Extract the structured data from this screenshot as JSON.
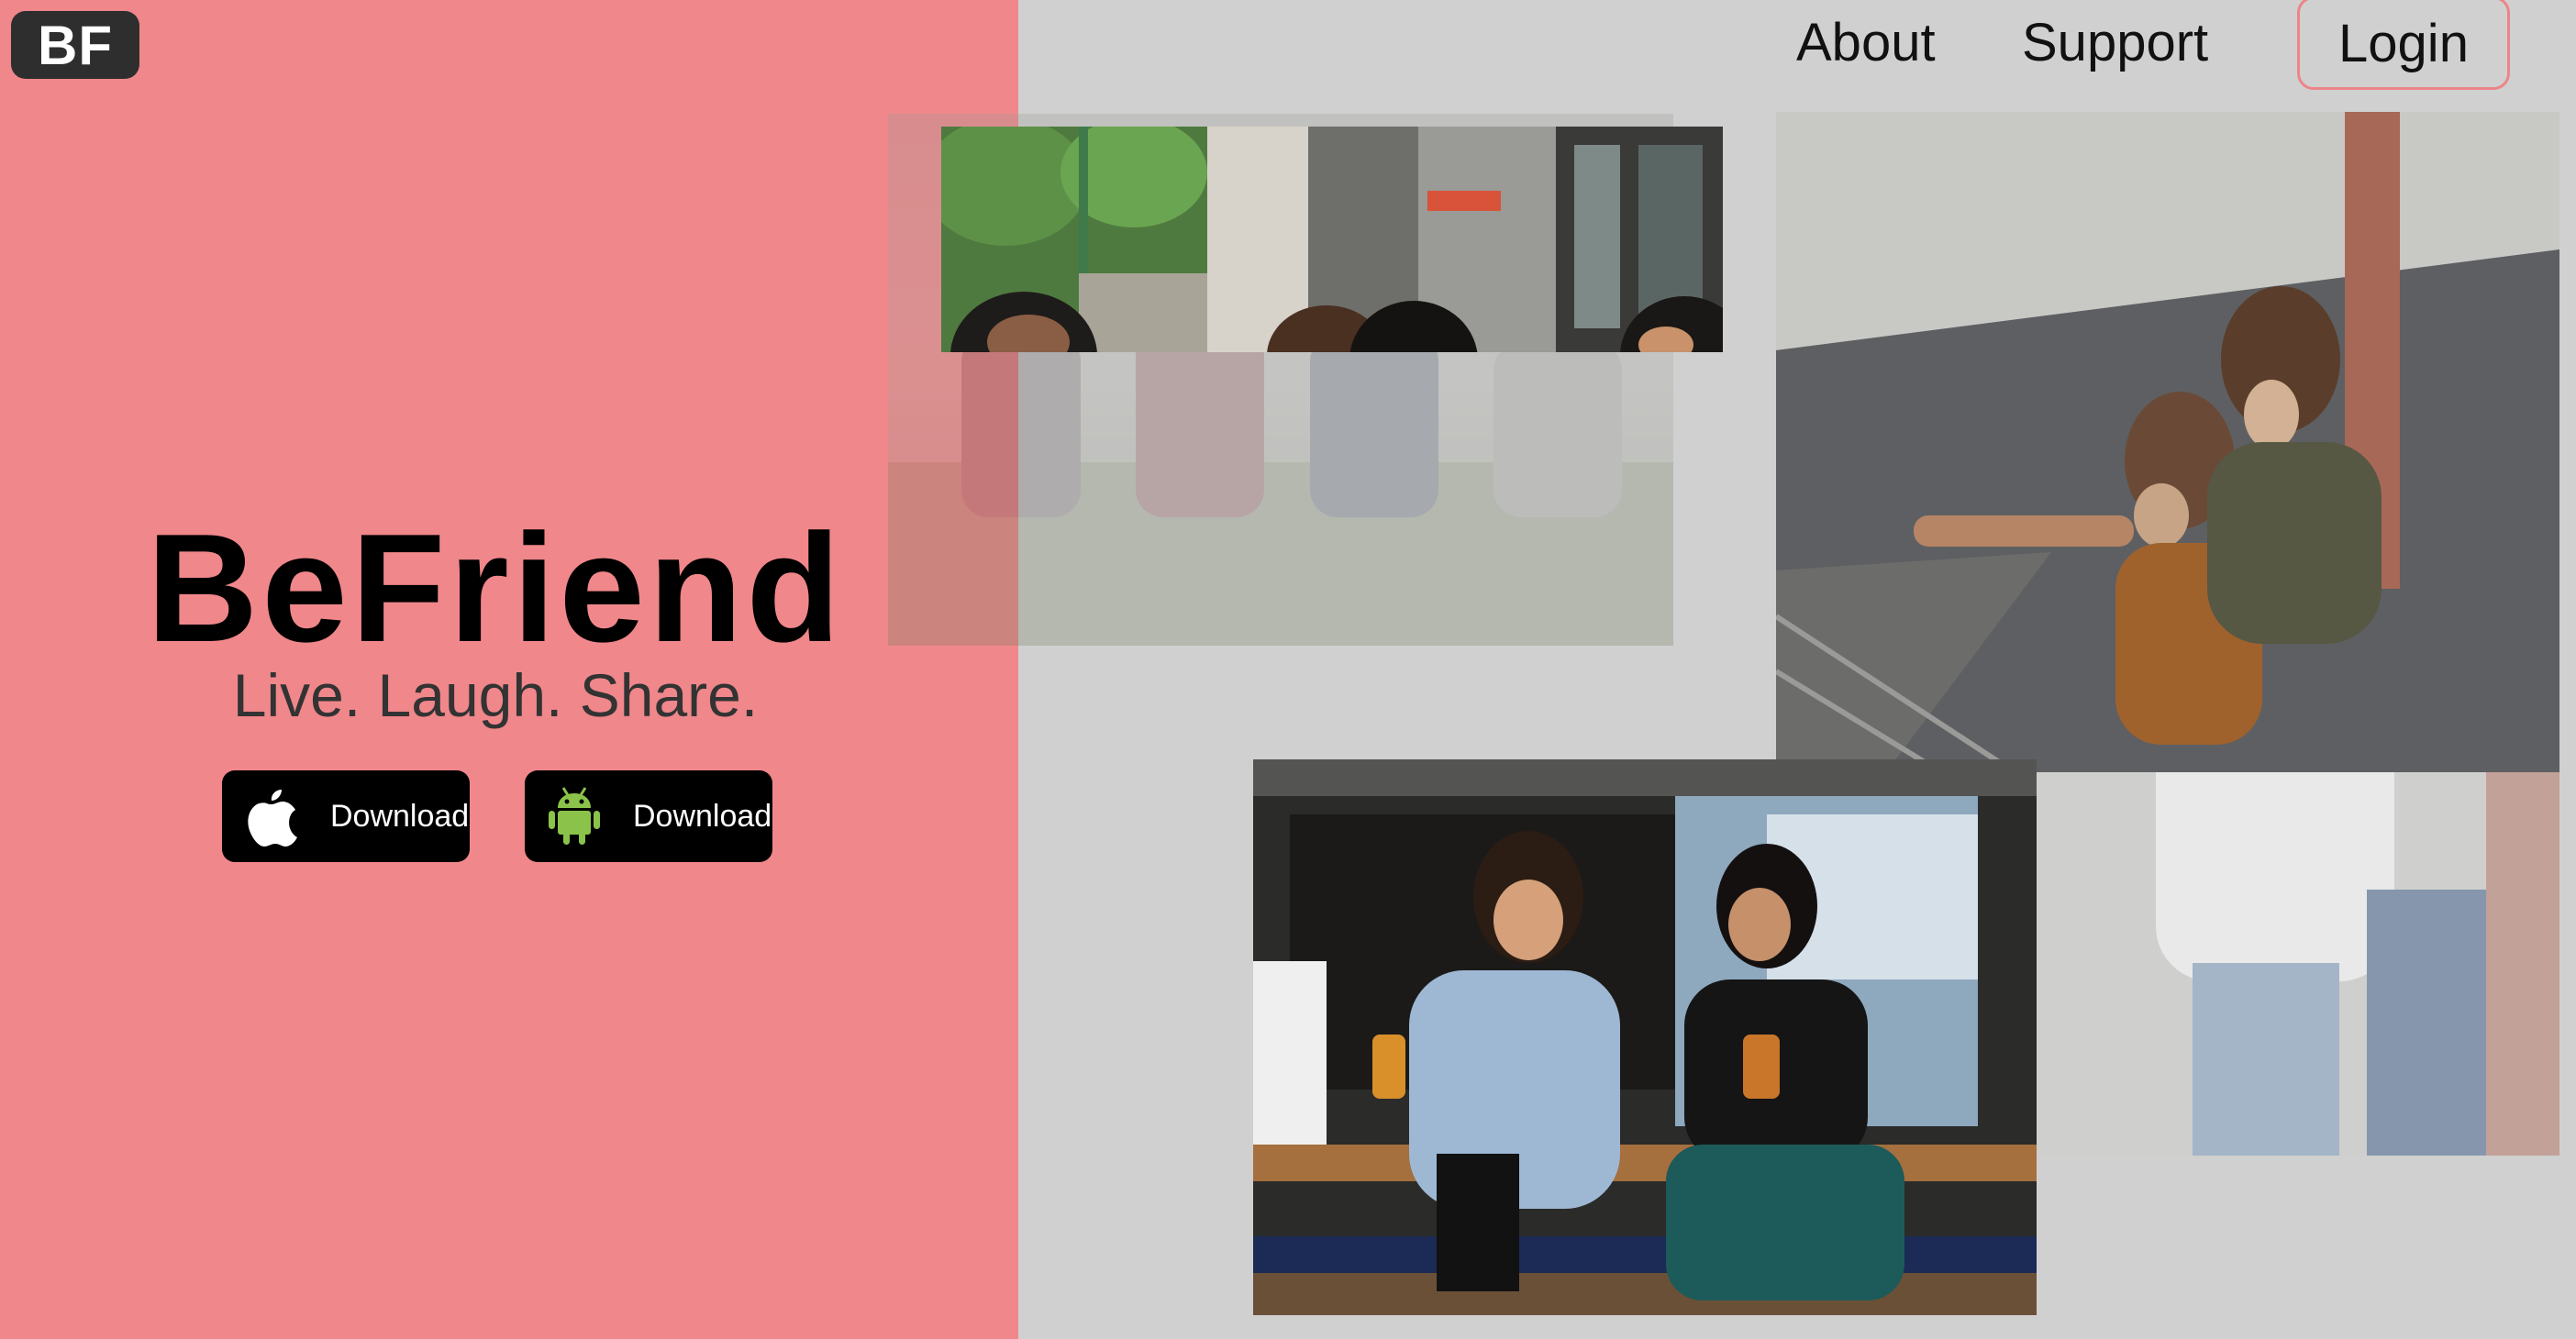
{
  "logo": {
    "text": "BF"
  },
  "nav": {
    "about": "About",
    "support": "Support",
    "login": "Login"
  },
  "hero": {
    "title": "BeFriend",
    "tagline": "Live. Laugh. Share."
  },
  "downloads": {
    "ios": {
      "label": "Download",
      "icon": "apple-icon"
    },
    "android": {
      "label": "Download",
      "icon": "android-icon"
    }
  },
  "colors": {
    "hero_panel": "#f0878b",
    "page_background": "#d0d0d0",
    "login_border": "#ec8589",
    "button_bg": "#000000",
    "android_green": "#8bc34a",
    "logo_bg": "#2e2e2e"
  }
}
